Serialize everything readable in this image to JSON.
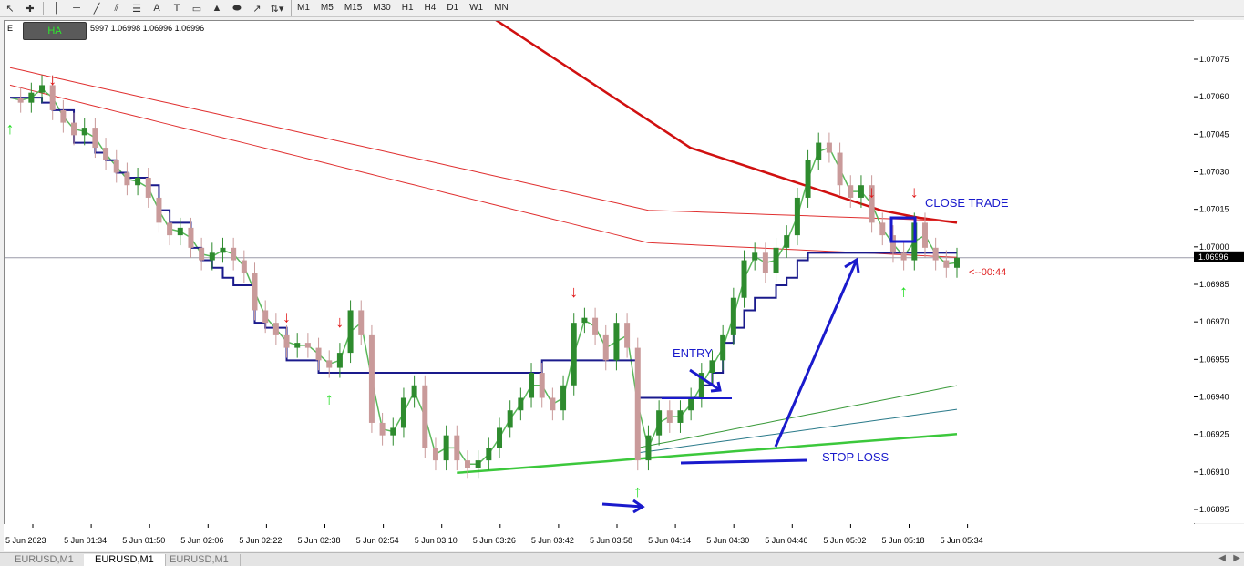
{
  "toolbar": {
    "icons": [
      "cursor-icon",
      "crosshair-icon",
      "vertical-line-icon",
      "horizontal-line-icon",
      "trendline-icon",
      "channel-icon",
      "fibonacci-icon",
      "text-icon",
      "label-icon",
      "rectangle-icon",
      "triangle-icon",
      "ellipse-icon",
      "fibo-fan-icon",
      "arrows-icon"
    ],
    "timeframes": [
      "M1",
      "M5",
      "M15",
      "M30",
      "H1",
      "H4",
      "D1",
      "W1",
      "MN"
    ]
  },
  "chart_header": {
    "symbol_prefix": "E",
    "ohlc_text": "5997 1.06998 1.06996 1.06996",
    "indicator_badge": "HA"
  },
  "tabs": [
    "EURUSD,M1",
    "EURUSD,M1",
    "EURUSD,M1"
  ],
  "annotations": {
    "entry": "ENTRY",
    "close_trade": "CLOSE TRADE",
    "stop_loss": "STOP LOSS",
    "countdown": "<--00:44"
  },
  "colors": {
    "bull_candle": "#2e8b2e",
    "bear_candle": "#c99a9a",
    "envelope_line": "#1a1a8c",
    "slow_ma": "#d01010",
    "fast_ma": "#e03030",
    "green_ma": "#3cc83c",
    "teal_ma": "#2a7a8a",
    "annotation_blue": "#1a1acc",
    "buy_arrow": "#22dd22",
    "sell_arrow": "#e01010",
    "price_marker": "#000000"
  },
  "chart_data": {
    "type": "candlestick",
    "symbol": "EURUSD",
    "timeframe": "M1",
    "current_price": "1.06996",
    "ylim": [
      1.0689,
      1.0709
    ],
    "y_ticks": [
      "1.07075",
      "1.07060",
      "1.07045",
      "1.07030",
      "1.07015",
      "1.07000",
      "1.06985",
      "1.06970",
      "1.06955",
      "1.06940",
      "1.06925",
      "1.06910",
      "1.06895"
    ],
    "x_ticks": [
      "5 Jun 2023",
      "5 Jun 01:34",
      "5 Jun 01:50",
      "5 Jun 02:06",
      "5 Jun 02:22",
      "5 Jun 02:38",
      "5 Jun 02:54",
      "5 Jun 03:10",
      "5 Jun 03:26",
      "5 Jun 03:42",
      "5 Jun 03:58",
      "5 Jun 04:14",
      "5 Jun 04:30",
      "5 Jun 04:46",
      "5 Jun 05:02",
      "5 Jun 05:18",
      "5 Jun 05:34"
    ],
    "closes": [
      1.0706,
      1.07058,
      1.07062,
      1.07065,
      1.07055,
      1.0705,
      1.07045,
      1.07048,
      1.0704,
      1.07035,
      1.0703,
      1.07025,
      1.07028,
      1.0702,
      1.0701,
      1.07005,
      1.07008,
      1.07,
      1.06995,
      1.06998,
      1.07,
      1.06995,
      1.0699,
      1.06975,
      1.0697,
      1.06965,
      1.0696,
      1.06962,
      1.0696,
      1.06955,
      1.06952,
      1.06958,
      1.06975,
      1.06965,
      1.0693,
      1.06925,
      1.06928,
      1.0694,
      1.06945,
      1.0692,
      1.06915,
      1.06925,
      1.06915,
      1.06912,
      1.06915,
      1.0692,
      1.06928,
      1.06935,
      1.0694,
      1.0695,
      1.0694,
      1.06935,
      1.06945,
      1.0697,
      1.06972,
      1.06965,
      1.06955,
      1.0697,
      1.0696,
      1.06915,
      1.06925,
      1.06935,
      1.0693,
      1.06935,
      1.0694,
      1.0695,
      1.06955,
      1.06965,
      1.0698,
      1.06995,
      1.06998,
      1.0699,
      1.07,
      1.07005,
      1.0702,
      1.07035,
      1.07042,
      1.07038,
      1.07025,
      1.0702,
      1.07025,
      1.0701,
      1.07005,
      1.06998,
      1.06995,
      1.0701,
      1.07,
      1.06995,
      1.06992,
      1.06996
    ],
    "envelope": [
      1.0706,
      1.0706,
      1.0706,
      1.07058,
      1.07055,
      1.07055,
      1.07042,
      1.07042,
      1.07038,
      1.07035,
      1.0703,
      1.07028,
      1.07028,
      1.07025,
      1.07015,
      1.0701,
      1.0701,
      1.07,
      1.06995,
      1.06992,
      1.06988,
      1.06985,
      1.06985,
      1.0697,
      1.06968,
      1.06968,
      1.06955,
      1.06955,
      1.06955,
      1.0695,
      1.0695,
      1.0695,
      1.0695,
      1.0695,
      1.0695,
      1.0695,
      1.0695,
      1.0695,
      1.0695,
      1.0695,
      1.0695,
      1.0695,
      1.0695,
      1.0695,
      1.0695,
      1.0695,
      1.0695,
      1.0695,
      1.0695,
      1.0695,
      1.06955,
      1.06955,
      1.06955,
      1.06955,
      1.06955,
      1.06955,
      1.06955,
      1.06955,
      1.06955,
      1.0694,
      1.0694,
      1.0694,
      1.0694,
      1.0694,
      1.0694,
      1.06945,
      1.0695,
      1.06962,
      1.06968,
      1.06975,
      1.0698,
      1.0698,
      1.06985,
      1.06988,
      1.06995,
      1.06998,
      1.06998,
      1.06998,
      1.06998,
      1.06998,
      1.06998,
      1.06998,
      1.06998,
      1.06998,
      1.06998,
      1.06998,
      1.06998,
      1.06998,
      1.06998,
      1.06998
    ],
    "slow_ma": [
      1.0715,
      1.0714,
      1.0713,
      1.0712,
      1.0711,
      1.071,
      1.0709,
      1.0708,
      1.0707,
      1.0706,
      1.0705,
      1.0704,
      1.07035,
      1.0703,
      1.07025,
      1.0702,
      1.07015,
      1.07012,
      1.0701
    ],
    "slow_ma_x_start": 0.28,
    "sell_signals": [
      4,
      26,
      31,
      53,
      81,
      85
    ],
    "buy_signals": [
      0,
      30,
      59,
      84
    ]
  }
}
